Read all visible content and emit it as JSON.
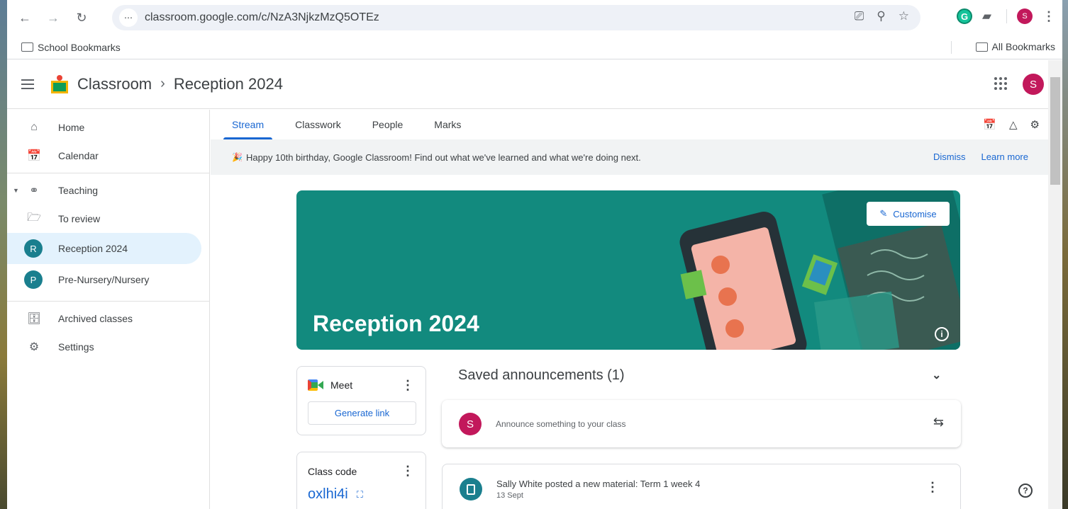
{
  "browser": {
    "url": "classroom.google.com/c/NzA3NjkzMzQ5OTEz",
    "profile_initial": "S",
    "grammarly_letter": "G"
  },
  "bookmarks": {
    "school_folder": "School Bookmarks",
    "all": "All Bookmarks"
  },
  "header": {
    "app_name": "Classroom",
    "class_name": "Reception 2024",
    "avatar_initial": "S"
  },
  "sidebar": {
    "items": [
      {
        "label": "Home"
      },
      {
        "label": "Calendar"
      },
      {
        "label": "Teaching"
      },
      {
        "label": "To review"
      },
      {
        "label": "Reception 2024",
        "initial": "R"
      },
      {
        "label": "Pre-Nursery/Nursery",
        "initial": "P"
      },
      {
        "label": "Archived classes"
      },
      {
        "label": "Settings"
      }
    ]
  },
  "tabs": [
    "Stream",
    "Classwork",
    "People",
    "Marks"
  ],
  "banner": {
    "message": "Happy 10th birthday, Google Classroom! Find out what we've learned and what we're doing next.",
    "dismiss": "Dismiss",
    "learn_more": "Learn more"
  },
  "hero": {
    "title": "Reception 2024",
    "customise": "Customise",
    "color": "#128a7e"
  },
  "meet": {
    "label": "Meet",
    "generate": "Generate link"
  },
  "class_code": {
    "label": "Class code",
    "code": "oxlhi4i"
  },
  "stream": {
    "saved_title": "Saved announcements (1)",
    "announce_placeholder": "Announce something to your class",
    "announce_avatar": "S",
    "post_title": "Sally White posted a new material: Term 1 week 4",
    "post_date": "13 Sept"
  }
}
